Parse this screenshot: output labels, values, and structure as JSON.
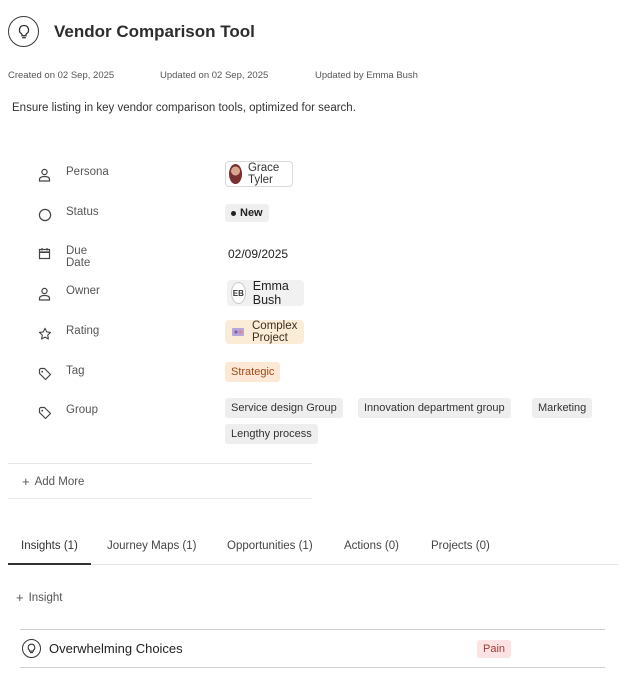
{
  "header": {
    "title": "Vendor Comparison Tool",
    "icon": "lightbulb-icon"
  },
  "meta": {
    "created": "Created on 02 Sep, 2025",
    "updated": "Updated on 02 Sep, 2025",
    "updated_by": "Updated by Emma Bush"
  },
  "description": "Ensure listing in key vendor comparison tools, optimized for search.",
  "properties": {
    "persona": {
      "label": "Persona",
      "icon": "person-icon",
      "value": "Grace Tyler"
    },
    "status": {
      "label": "Status",
      "icon": "circle-icon",
      "value": "New"
    },
    "due_date": {
      "label": "Due Date",
      "icon": "calendar-icon",
      "value": "02/09/2025"
    },
    "owner": {
      "label": "Owner",
      "icon": "person-icon",
      "initials": "EB",
      "value": "Emma Bush"
    },
    "rating": {
      "label": "Rating",
      "icon": "star-icon",
      "value": "Complex Project"
    },
    "tag": {
      "label": "Tag",
      "icon": "tag-icon",
      "value": "Strategic"
    },
    "group": {
      "label": "Group",
      "icon": "tag-icon",
      "values": [
        "Service design Group",
        "Innovation department group",
        "Marketing",
        "Lengthy process"
      ]
    }
  },
  "add_more": "Add More",
  "tabs": [
    {
      "label": "Insights (1)",
      "active": true
    },
    {
      "label": "Journey Maps (1)",
      "active": false
    },
    {
      "label": "Opportunities (1)",
      "active": false
    },
    {
      "label": "Actions (0)",
      "active": false
    },
    {
      "label": "Projects (0)",
      "active": false
    }
  ],
  "add_insight": "Insight",
  "insights": [
    {
      "title": "Overwhelming Choices",
      "badge": "Pain"
    }
  ],
  "colors": {
    "tag_bg": "#fde8d6",
    "rating_bg": "#fbecd7",
    "pain_bg": "#fbe3e3",
    "pain_text": "#a33a3a"
  }
}
